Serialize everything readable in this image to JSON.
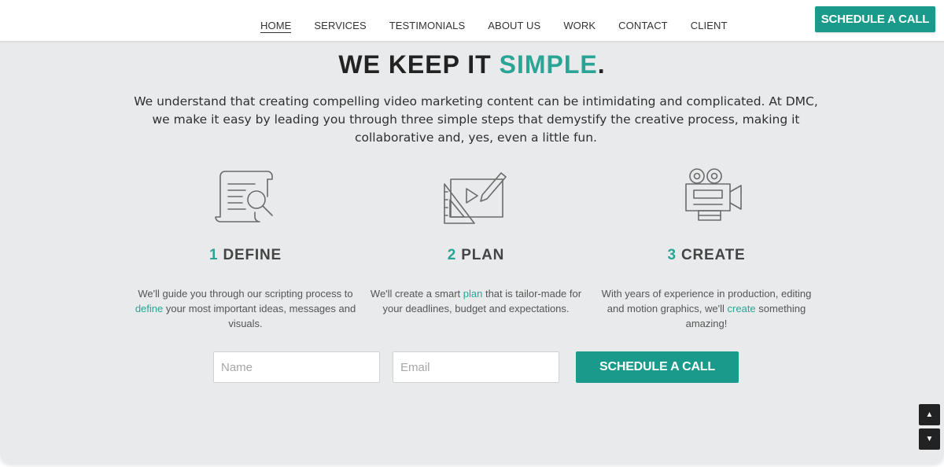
{
  "nav": {
    "links": [
      "HOME",
      "SERVICES",
      "TESTIMONIALS",
      "ABOUT US",
      "WORK",
      "CONTACT",
      "CLIENT"
    ],
    "active": "HOME",
    "cta_label": "SCHEDULE A CALL"
  },
  "hero": {
    "headline_main": "WE KEEP IT ",
    "headline_accent": "SIMPLE",
    "headline_end": ".",
    "intro_text": "We understand that creating compelling video marketing content can be intimidating and complicated. At DMC, we make it easy by leading you through three simple steps that demystify the creative process, making it collaborative and, yes, even a little fun."
  },
  "steps": [
    {
      "icon": "document-search-icon",
      "number": "1",
      "title": "DEFINE",
      "desc_before": "We'll guide you through our scripting process to ",
      "desc_highlight": "define",
      "desc_after": " your most important ideas, messages and visuals."
    },
    {
      "icon": "plan-drawing-icon",
      "number": "2",
      "title": "PLAN",
      "desc_before": "We'll create a smart ",
      "desc_highlight": "plan",
      "desc_after": " that is tailor-made for your deadlines, budget and expectations."
    },
    {
      "icon": "film-camera-icon",
      "number": "3",
      "title": "CREATE",
      "desc_before": "With years of experience in production, editing and motion graphics, we'll ",
      "desc_highlight": "create",
      "desc_after": " something amazing!"
    }
  ],
  "form": {
    "name_placeholder": "Name",
    "email_placeholder": "Email",
    "submit_label": "SCHEDULE A CALL"
  },
  "scroll": {
    "up_glyph": "▲",
    "down_glyph": "▼"
  },
  "colors": {
    "accent": "#2aa595",
    "button": "#1a9a8a",
    "background": "#e9eaeb"
  }
}
